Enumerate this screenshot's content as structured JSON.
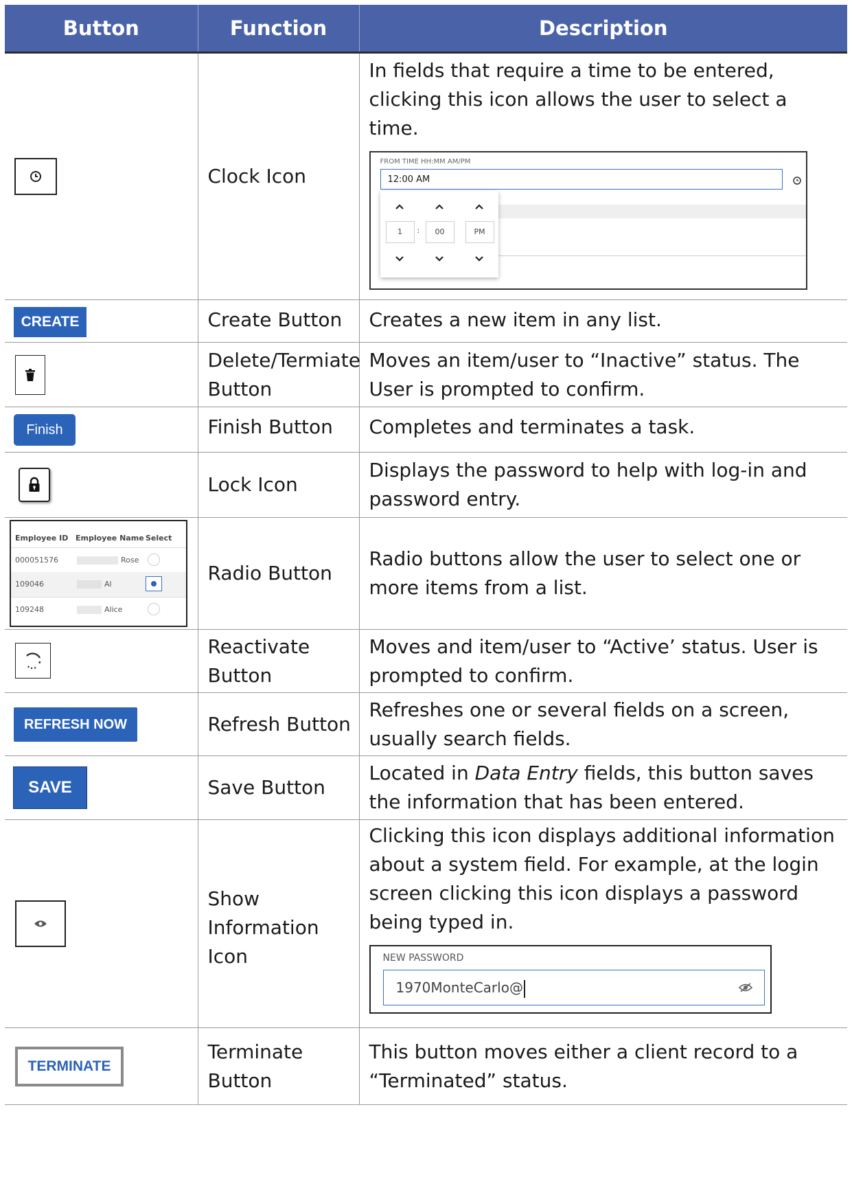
{
  "headers": [
    "Button",
    "Function",
    "Description"
  ],
  "rows": {
    "clock": {
      "function": "Clock Icon",
      "description": "In fields that require a time to be entered, clicking this icon allows the user to select a time.",
      "picker_label": "FROM TIME HH:MM AM/PM",
      "picker_value": "12:00 AM",
      "picker_hour": "1",
      "picker_separator": ":",
      "picker_minute": "00",
      "picker_period": "PM"
    },
    "create": {
      "button_label": "CREATE",
      "function": "Create Button",
      "description": "Creates a new item in any list."
    },
    "delete": {
      "function": "Delete/Termiate Button",
      "description": "Moves an item/user to “Inactive” status. The User is prompted to confirm."
    },
    "finish": {
      "button_label": "Finish",
      "function": "Finish Button",
      "description": "Completes and terminates a task."
    },
    "lock": {
      "function": "Lock Icon",
      "description": "Displays the password to help with log-in and password entry."
    },
    "radio": {
      "function": "Radio Button",
      "description": "Radio buttons allow the user to select one or more items from a list.",
      "col_id": "Employee ID",
      "col_name": "Employee Name",
      "col_select": "Select",
      "items": [
        {
          "id": "000051576",
          "name": "Rose"
        },
        {
          "id": "109046",
          "name": "Al"
        },
        {
          "id": "109248",
          "name": "Alice"
        }
      ],
      "selected_index": 1
    },
    "reactivate": {
      "function": "Reactivate Button",
      "description": "Moves and item/user to “Active’ status. User is prompted to confirm."
    },
    "refresh": {
      "button_label": "REFRESH NOW",
      "function": "Refresh Button",
      "description": "Refreshes one or several fields on a screen, usually search fields."
    },
    "save": {
      "button_label": "SAVE",
      "function": "Save Button",
      "description_pre": "Located in ",
      "description_em": "Data Entry",
      "description_post": " fields, this button saves the information that has been entered."
    },
    "show_info": {
      "function": "Show Information Icon",
      "description": "Clicking this icon displays additional information about a system field.  For example, at the login screen clicking this icon displays a password being typed in.",
      "pw_label": "NEW PASSWORD",
      "pw_value": "1970MonteCarlo@"
    },
    "terminate": {
      "button_label": "TERMINATE",
      "function": "Terminate Button",
      "description": "This button moves either a client record to a “Terminated” status."
    }
  },
  "colors": {
    "header_bg": "#4a63a8",
    "button_blue": "#2b63b8",
    "terminate_text": "#2b63b8"
  },
  "icons": [
    "clock-icon",
    "trash-icon",
    "lock-icon",
    "reactivate-icon",
    "eye-icon",
    "eye-slash-icon",
    "chevron-up-icon",
    "chevron-down-icon"
  ]
}
